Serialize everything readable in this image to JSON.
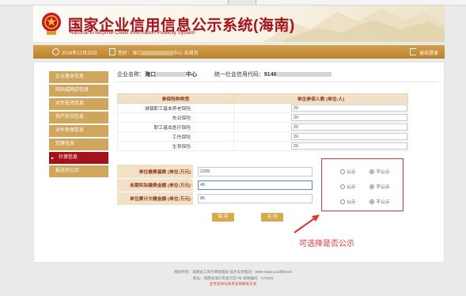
{
  "header": {
    "title": "国家企业信用信息公示系统(海南)",
    "subtitle": "National Enterprise Credit Information Publicity System"
  },
  "infobar": {
    "date": "2016年12月25日",
    "account_prefix": "您好：海口",
    "account_middle": "中心",
    "account_suffix": "  去首页",
    "logout": "退出登录"
  },
  "sidebar": {
    "items": [
      {
        "label": "企业基本信息",
        "active": false
      },
      {
        "label": "网站或网店信息",
        "active": false
      },
      {
        "label": "对外投资信息",
        "active": false
      },
      {
        "label": "资产状况信息",
        "active": false
      },
      {
        "label": "对外担保信息",
        "active": false
      },
      {
        "label": "党建信息",
        "active": false
      },
      {
        "label": "社保信息",
        "active": true
      },
      {
        "label": "报送并公示",
        "active": false
      }
    ]
  },
  "company": {
    "name_label": "企业名称：",
    "name_value_start": "海口",
    "name_value_end": "中心",
    "code_label": "统一社会信用代码：",
    "code_value_start": "9146"
  },
  "insurance_table": {
    "headers": [
      "参保险种类型",
      "单位参保人数 (单位:人)"
    ],
    "rows": [
      {
        "type": "城镇职工基本养老保险",
        "count": "20"
      },
      {
        "type": "失业保险",
        "count": "20"
      },
      {
        "type": "职工基本医疗保险",
        "count": "20"
      },
      {
        "type": "工伤保险",
        "count": "20"
      },
      {
        "type": "生育保险",
        "count": "20"
      }
    ]
  },
  "finance": {
    "rows": [
      {
        "label": "单位缴费基数 (单位:万元)",
        "value": "2299",
        "public_label": "公示",
        "private_label": "不公示",
        "selected": "private"
      },
      {
        "label": "本期实际缴费金额 (单位:万元)",
        "value": "45",
        "public_label": "公示",
        "private_label": "不公示",
        "selected": "private"
      },
      {
        "label": "单位累计欠缴金额 (单位:万元)",
        "value": "85",
        "public_label": "公示",
        "private_label": "不公示",
        "selected": "private"
      }
    ]
  },
  "buttons": {
    "save": "保 存",
    "close": "关 闭"
  },
  "annotation": "可选择是否公示",
  "footer": {
    "line1": "版权所有：海南省工商行政管理局 技术支持电话：0898-66521115转8019",
    "line2": "地址：海南省海口市美兰区7号 邮政编码：570206",
    "line3": "业务咨询与技术支持联系方式"
  },
  "colors": {
    "brand_red": "#a7121a",
    "gold": "#d0a65d",
    "header_beige": "#f3e1c7",
    "annotation_red": "#e53535"
  }
}
